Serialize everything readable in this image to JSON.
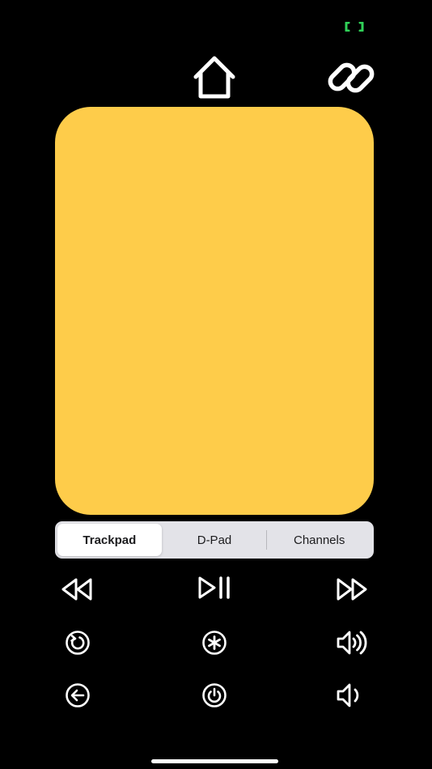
{
  "status": {
    "indicator_color": "#30D158",
    "indicator_icon": "connection-indicator-icon"
  },
  "header": {
    "home_icon": "home-icon",
    "link_icon": "link-icon"
  },
  "trackpad": {
    "color": "#FECC4A"
  },
  "mode_selector": {
    "selected": "Trackpad",
    "segments": [
      {
        "label": "Trackpad"
      },
      {
        "label": "D-Pad"
      },
      {
        "label": "Channels"
      }
    ]
  },
  "controls": {
    "row1": [
      "rewind-icon",
      "play-pause-icon",
      "fast-forward-icon"
    ],
    "row2": [
      "replay-icon",
      "options-asterisk-icon",
      "volume-up-icon"
    ],
    "row3": [
      "back-arrow-icon",
      "power-icon",
      "volume-down-icon"
    ]
  }
}
